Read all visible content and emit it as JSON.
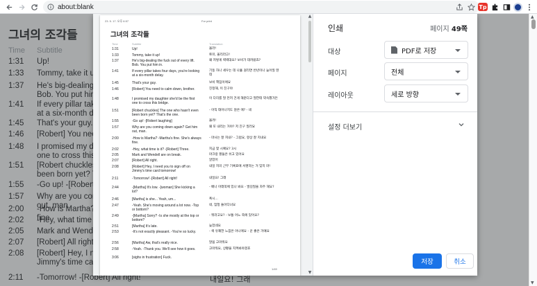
{
  "browser": {
    "url": "about:blank",
    "icons": [
      "back-arrow-icon",
      "forward-arrow-icon",
      "reload-icon",
      "info-icon",
      "share-icon",
      "star-icon",
      "extension-tp-icon",
      "puzzle-icon",
      "sidebar-icon",
      "profile-avatar",
      "more-icon"
    ],
    "ext_label": "Tp"
  },
  "page": {
    "title": "그녀의 조각들",
    "headers": {
      "time": "Time",
      "subtitle": "Subtitle"
    },
    "rows": [
      {
        "time": "1:31",
        "subtitle": "Up!",
        "translation": ""
      },
      {
        "time": "1:33",
        "subtitle": "Tommy, take it up!",
        "translation": ""
      },
      {
        "time": "1:37",
        "subtitle": "He's big-dealing the fuck out of every lift. Bob. You put him in.",
        "translation": ""
      },
      {
        "time": "1:41",
        "subtitle": "If every pillar takes four days, you're looking at a six-month delay.",
        "translation": ""
      },
      {
        "time": "1:45",
        "subtitle": "That's your guy.",
        "translation": ""
      },
      {
        "time": "1:46",
        "subtitle": "[Robert] You need to calm down, brother.",
        "translation": ""
      },
      {
        "time": "1:48",
        "subtitle": "I promised my daughter she'd be the first one to cross this bridge.",
        "translation": ""
      },
      {
        "time": "1:51",
        "subtitle": "[Robert chuckles] The one who hasn't even been born yet? That's the one.",
        "translation": ""
      },
      {
        "time": "1:55",
        "subtitle": "-Go up! -[Robert laughing]",
        "translation": ""
      },
      {
        "time": "1:57",
        "subtitle": "Why are you coming down again? Get him out, man.",
        "translation": ""
      },
      {
        "time": "2:00",
        "subtitle": "-How is Martha? -Martha's fine. She's always fine.",
        "translation": ""
      },
      {
        "time": "2:02",
        "subtitle": "-Hey, what time is it? -[Robert] Three.",
        "translation": ""
      },
      {
        "time": "2:05",
        "subtitle": "Mark and Wendell are on break.",
        "translation": ""
      },
      {
        "time": "2:07",
        "subtitle": "[Robert] All right.",
        "translation": ""
      },
      {
        "time": "2:08",
        "subtitle": "[Robert] Hey, I need you to sign off on Jimmy's time card tomorrow!",
        "translation": ""
      },
      {
        "time": "2:11",
        "subtitle": "-Tomorrow! -[Robert] All right!",
        "translation": "내일요! 그래"
      }
    ]
  },
  "print_dialog": {
    "title": "인쇄",
    "page_count_value": "49",
    "page_count_suffix": "쪽",
    "page_count_prefix": "페이지 ",
    "destination_label": "대상",
    "destination_value": "PDF로 저장",
    "pages_label": "페이지",
    "pages_value": "전체",
    "layout_label": "레이아웃",
    "layout_value": "세로 방향",
    "more_settings": "설정 더보기",
    "save_button": "저장",
    "cancel_button": "취소"
  },
  "preview": {
    "date": "23. 5. 17. 오후 6:57",
    "site": "For print",
    "title": "그녀의 조각들",
    "headers": {
      "time": "Time",
      "subtitle": "Subtitle",
      "translation": "Translation"
    },
    "page_number": "1/49",
    "rows": [
      {
        "time": "1:31",
        "subtitle": "Up!",
        "translation": "올라!"
      },
      {
        "time": "1:33",
        "subtitle": "Tommy, take it up!",
        "translation": "토미, 올리라고!"
      },
      {
        "time": "1:37",
        "subtitle": "He's big-dealing the fuck out of every lift. Bob. You put him in.",
        "translation": "왜 저렇게 벽벽대요? 보비가 데려왔죠?"
      },
      {
        "time": "1:41",
        "subtitle": "If every pillar takes four days, you're looking at a six-month delay.",
        "translation": "기둥 하나 세우는 데 나흘 걸리면 반년이나 늦어질 텐데"
      },
      {
        "time": "1:45",
        "subtitle": "That's your guy.",
        "translation": "보비 책임이에요"
      },
      {
        "time": "1:46",
        "subtitle": "[Robert] You need to calm down, brother.",
        "translation": "진정해, 이 친구야"
      },
      {
        "time": "1:48",
        "subtitle": "I promised my daughter she'd be the first one to cross this bridge.",
        "translation": "이 다리를 딸 먼저 건게 해준다고 딸한테 약속했거든"
      },
      {
        "time": "1:51",
        "subtitle": "[Robert chuckles] The one who hasn't even been born yet? That's the one.",
        "translation": "- 아직 태어나지도 않은 애? - 네"
      },
      {
        "time": "1:55",
        "subtitle": "-Go up! -[Robert laughing]",
        "translation": "올려!"
      },
      {
        "time": "1:57",
        "subtitle": "Why are you coming down again? Get him out, man.",
        "translation": "왜 또 내리는 거야? 저 친구 질러요"
      },
      {
        "time": "2:00",
        "subtitle": "-How is Martha? -Martha's fine. She's always fine.",
        "translation": "- 마사는 잘 지내? - 그럼요, 항상 잘 지내요"
      },
      {
        "time": "2:02",
        "subtitle": "-Hey, what time is it? -[Robert] Three.",
        "translation": "지금 몇 시예요? 3시"
      },
      {
        "time": "2:05",
        "subtitle": "Mark and Wendell are on break.",
        "translation": "마크랑 웬들은 쉬고 있어요"
      },
      {
        "time": "2:07",
        "subtitle": "[Robert] All right.",
        "translation": "알았어"
      },
      {
        "time": "2:08",
        "subtitle": "[Robert] Hey, I need you to sign off on Jimmy's time card tomorrow!",
        "translation": "내일 지미 근무 기록표에 서명하는 거 잊지 마!"
      },
      {
        "time": "2:11",
        "subtitle": "-Tomorrow! -[Robert] All right!",
        "translation": "내일요! 그래"
      },
      {
        "time": "2:44",
        "subtitle": "-[Martha] It's low. -[woman] She kicking a lot?",
        "translation": "- 배나 아래쪽에 있나 봐요 - 발길질을 자주 해요?"
      },
      {
        "time": "2:46",
        "subtitle": "[Martha] is she... Yeah, um...",
        "translation": "혹시..."
      },
      {
        "time": "2:47",
        "subtitle": "-Yeah. She's moving around a lot now. -Top or bottom?",
        "translation": "네, 엄청 돌아다녀요"
      },
      {
        "time": "2:49",
        "subtitle": "-[Martha] Sorry? -Is she mostly at the top or bottom?",
        "translation": "- 뭐라고요? - 보통 어느 쪽에 있어요?"
      },
      {
        "time": "2:51",
        "subtitle": "[Martha] It's late.",
        "translation": "늦었네요"
      },
      {
        "time": "2:53",
        "subtitle": "-It's not exactly pleasant. -You're so lucky.",
        "translation": "- 썩 유쾌한 느낌은 아니에요 - 운 좋은 거예요"
      },
      {
        "time": "2:56",
        "subtitle": "[Martha] Aw, that's really nice.",
        "translation": "말씀 고마워요"
      },
      {
        "time": "2:58",
        "subtitle": "-Yeah. -Thank you. We'll see how it goes.",
        "translation": "고마워요, 상황을 지켜봐야겠죠"
      },
      {
        "time": "3:06",
        "subtitle": "[sighs in frustration] Fuck.",
        "translation": ""
      }
    ]
  }
}
